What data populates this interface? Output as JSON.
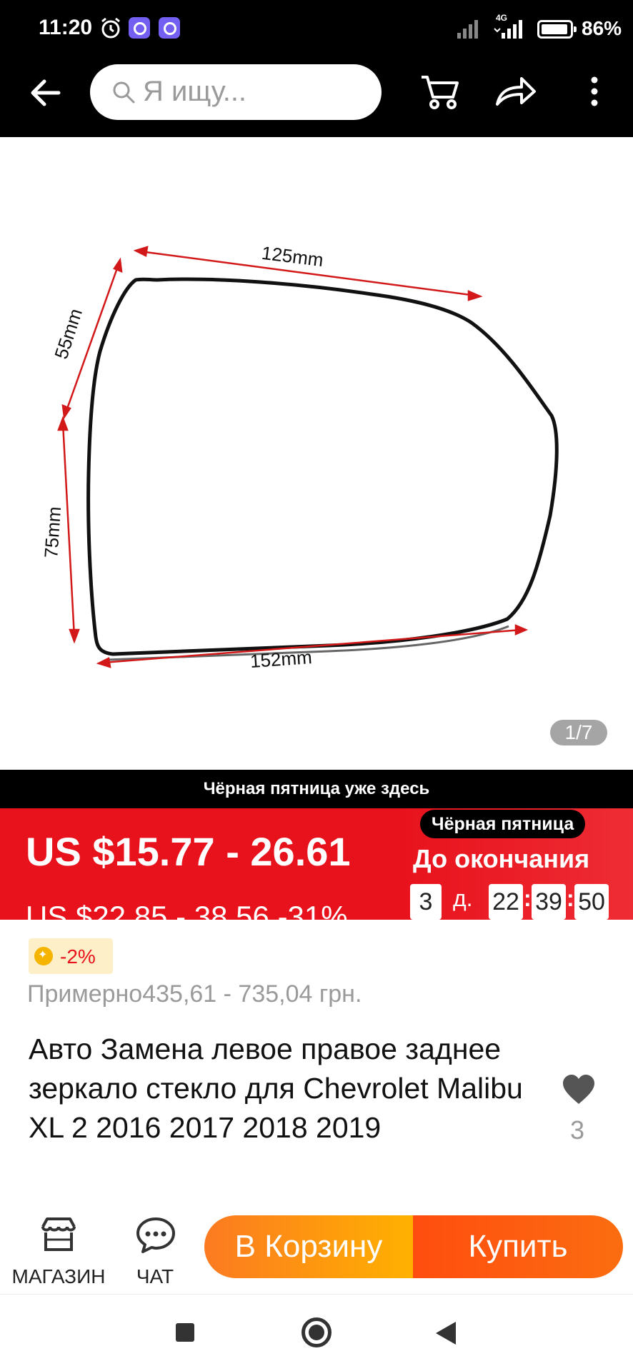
{
  "status_bar": {
    "time": "11:20",
    "network": "4G",
    "battery_percent": "86%",
    "battery_level": 0.86
  },
  "top_nav": {
    "search_placeholder": "Я ищу..."
  },
  "gallery": {
    "counter": "1/7",
    "dimensions": {
      "top": "125mm",
      "left_upper": "55mm",
      "left_lower": "75mm",
      "bottom": "152mm"
    }
  },
  "promo_strip": {
    "text": "Чёрная пятница уже здесь"
  },
  "price_banner": {
    "price": "US $15.77 - 26.61",
    "old_price": "US $22.85 - 38.56 -31%",
    "event_badge": "Чёрная пятница",
    "countdown_label": "До окончания",
    "countdown": {
      "days": "3",
      "days_unit": "д.",
      "hours": "22",
      "minutes": "39",
      "seconds": "50"
    }
  },
  "coin_discount": "-2%",
  "approx_price": "Примерно435,61 - 735,04 грн.",
  "product_title": "Авто Замена левое правое заднее зеркало стекло для Chevrolet Malibu XL 2 2016 2017 2018 2019",
  "wishlist": {
    "count": "3"
  },
  "action_bar": {
    "store_label": "МАГАЗИН",
    "chat_label": "ЧАТ",
    "add_to_cart_label": "В Корзину",
    "buy_label": "Купить"
  },
  "colors": {
    "accent_red": "#e8121c",
    "cart_orange": "#fc7a21",
    "buy_orange": "#ff4d0f"
  }
}
